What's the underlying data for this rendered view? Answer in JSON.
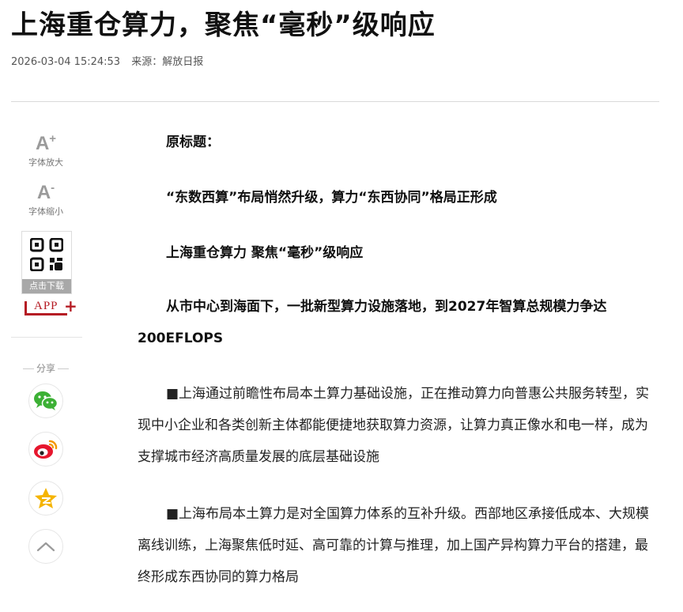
{
  "article": {
    "title": "上海重仓算力，聚焦“毫秒”级响应",
    "datetime": "2026-03-04 15:24:53",
    "source": "来源：解放日报",
    "paragraphs": [
      "原标题：",
      "“东数西算”布局悄然升级，算力“东西协同”格局正形成",
      "上海重仓算力 聚焦“毫秒”级响应",
      "从市中心到海面下，一批新型算力设施落地，到2027年智算总规模力争达200EFLOPS",
      "■上海通过前瞻性布局本土算力基础设施，正在推动算力向普惠公共服务转型，实现中小企业和各类创新主体都能便捷地获取算力资源，让算力真正像水和电一样，成为支撑城市经济高质量发展的底层基础设施",
      "■上海布局本土算力是对全国算力体系的互补升级。西部地区承接低成本、大规模离线训练，上海聚焦低时延、高可靠的计算与推理，加上国产异构算力平台的搭建，最终形成东西协同的算力格局"
    ]
  },
  "tools": {
    "font_increase": {
      "glyph": "A",
      "sup": "+",
      "label": "字体放大"
    },
    "font_decrease": {
      "glyph": "A",
      "sup": "-",
      "label": "字体缩小"
    },
    "qr_label": "点击下载",
    "app_label": "APP"
  },
  "share": {
    "label": "分享",
    "buttons": [
      {
        "name": "wechat",
        "icon": "wechat-icon",
        "color": "#3cb035"
      },
      {
        "name": "weibo",
        "icon": "weibo-icon",
        "color": "#e6162d"
      },
      {
        "name": "qzone",
        "icon": "qzone-star-icon",
        "color": "#f5b400"
      },
      {
        "name": "back-to-top",
        "icon": "chevron-up-icon",
        "color": "#999999"
      }
    ]
  },
  "colors": {
    "accent_red": "#b51c24",
    "divider": "#d9d9d9"
  }
}
